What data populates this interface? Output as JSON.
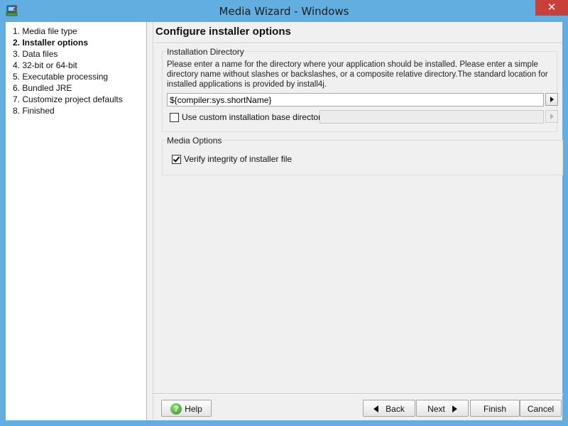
{
  "window": {
    "title": "Media Wizard - Windows",
    "close_glyph": "✕",
    "app_icon": "installer-app-icon"
  },
  "sidebar": {
    "steps": [
      {
        "label": "1. Media file type",
        "active": false
      },
      {
        "label": "2. Installer options",
        "active": true
      },
      {
        "label": "3. Data files",
        "active": false
      },
      {
        "label": "4. 32-bit or 64-bit",
        "active": false
      },
      {
        "label": "5. Executable processing",
        "active": false
      },
      {
        "label": "6. Bundled JRE",
        "active": false
      },
      {
        "label": "7. Customize project defaults",
        "active": false
      },
      {
        "label": "8. Finished",
        "active": false
      }
    ]
  },
  "main": {
    "title": "Configure installer options",
    "installation_directory": {
      "label": "Installation Directory",
      "description": "Please enter a name for the directory where your application should be installed. Please enter a simple directory name without slashes or backslashes, or a composite relative directory.The standard location for installed applications is provided by install4j.",
      "directory_value": "${compiler:sys.shortName}",
      "custom_base_checked": false,
      "custom_base_label": "Use custom installation base directory:",
      "custom_base_value": ""
    },
    "media_options": {
      "label": "Media Options",
      "verify_checked": true,
      "verify_label": "Verify integrity of installer file"
    }
  },
  "footer": {
    "help_label": "Help",
    "back_label": "Back",
    "next_label": "Next",
    "finish_label": "Finish",
    "cancel_label": "Cancel"
  }
}
